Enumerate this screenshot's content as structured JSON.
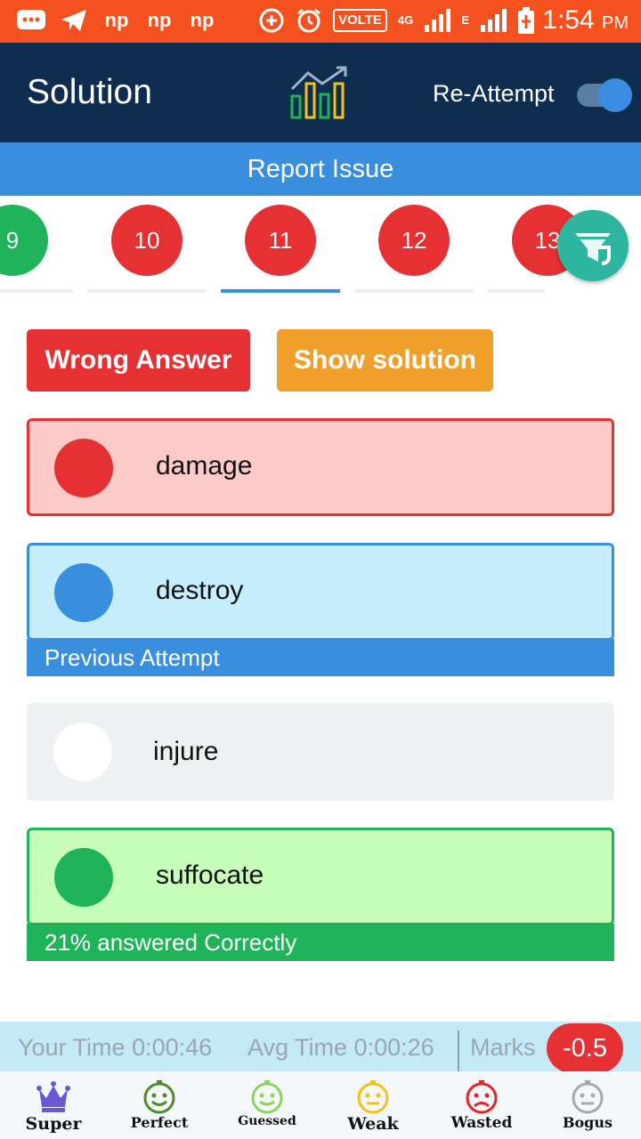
{
  "status_bar": {
    "left_icons": [
      "message-icon",
      "telegram-icon",
      "np-icon",
      "np-icon",
      "np-icon"
    ],
    "np_text": "np",
    "volte": "VOLTE",
    "network": "4G",
    "signal2_label": "E",
    "time": "1:54",
    "ampm": "PM"
  },
  "header": {
    "title": "Solution",
    "reattempt_label": "Re-Attempt",
    "reattempt_on": true
  },
  "report_issue": "Report Issue",
  "questions": [
    {
      "num": "9",
      "status": "correct",
      "color": "#1fb45a"
    },
    {
      "num": "10",
      "status": "wrong",
      "color": "#e53034"
    },
    {
      "num": "11",
      "status": "wrong",
      "color": "#e53034",
      "active": true
    },
    {
      "num": "12",
      "status": "wrong",
      "color": "#e53034"
    },
    {
      "num": "13",
      "status": "wrong",
      "color": "#e53034"
    }
  ],
  "actions": {
    "wrong_answer": "Wrong Answer",
    "show_solution": "Show solution"
  },
  "options": [
    {
      "text": "damage",
      "state": "selected-wrong"
    },
    {
      "text": "destroy",
      "state": "previous-attempt"
    },
    {
      "text": "injure",
      "state": "neutral"
    },
    {
      "text": "suffocate",
      "state": "correct"
    }
  ],
  "banners": {
    "previous_attempt": "Previous Attempt",
    "correct_stat": "21% answered Correctly"
  },
  "stats": {
    "your_time": "Your Time 0:00:46",
    "avg_time": "Avg Time 0:00:26",
    "marks_label": "Marks",
    "marks_value": "-0.5"
  },
  "bottom_nav": [
    {
      "label": "Super",
      "icon": "crown-icon",
      "color": "#6c57d6"
    },
    {
      "label": "Perfect",
      "icon": "smile-face-icon",
      "color": "#4e8c2a"
    },
    {
      "label": "Guessed",
      "icon": "smile-face-icon",
      "color": "#8bd45a"
    },
    {
      "label": "Weak",
      "icon": "neutral-face-icon",
      "color": "#f3c117"
    },
    {
      "label": "Wasted",
      "icon": "sad-face-icon",
      "color": "#e32621"
    },
    {
      "label": "Bogus",
      "icon": "neutral-face-icon",
      "color": "#a9a9a9"
    }
  ]
}
